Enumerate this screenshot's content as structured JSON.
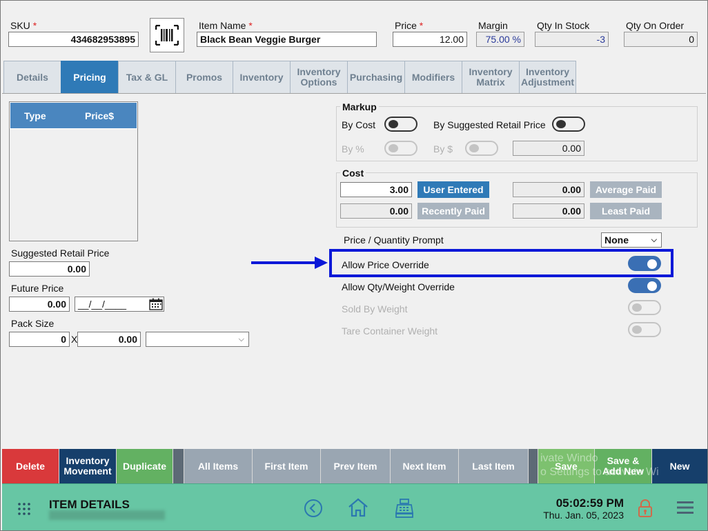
{
  "header": {
    "sku_label": "SKU",
    "sku_value": "434682953895",
    "item_name_label": "Item Name",
    "item_name_value": "Black Bean Veggie Burger",
    "price_label": "Price",
    "price_value": "12.00",
    "margin_label": "Margin",
    "margin_value": "75.00 %",
    "qty_in_stock_label": "Qty In Stock",
    "qty_in_stock_value": "-3",
    "qty_on_order_label": "Qty On Order",
    "qty_on_order_value": "0",
    "required_mark": "*"
  },
  "tabs": [
    {
      "line1": "Details",
      "line2": ""
    },
    {
      "line1": "Pricing",
      "line2": ""
    },
    {
      "line1": "Tax & GL",
      "line2": ""
    },
    {
      "line1": "Promos",
      "line2": ""
    },
    {
      "line1": "Inventory",
      "line2": ""
    },
    {
      "line1": "Inventory",
      "line2": "Options"
    },
    {
      "line1": "Purchasing",
      "line2": ""
    },
    {
      "line1": "Modifiers",
      "line2": ""
    },
    {
      "line1": "Inventory",
      "line2": "Matrix"
    },
    {
      "line1": "Inventory",
      "line2": "Adjustment"
    }
  ],
  "active_tab": "Pricing",
  "price_table": {
    "col_type": "Type",
    "col_price": "Price$"
  },
  "left": {
    "suggested_retail_label": "Suggested Retail Price",
    "suggested_retail_value": "0.00",
    "future_price_label": "Future Price",
    "future_price_value": "0.00",
    "future_date_value": "__/__/____",
    "pack_size_label": "Pack Size",
    "pack_qty_value": "0",
    "pack_x": "X",
    "pack_price_value": "0.00",
    "pack_unit_value": ""
  },
  "markup": {
    "title": "Markup",
    "by_cost_label": "By Cost",
    "by_suggested_label": "By Suggested Retail Price",
    "by_percent_label": "By %",
    "by_dollar_label": "By $",
    "markup_value": "0.00"
  },
  "cost": {
    "title": "Cost",
    "cost_value": "3.00",
    "user_entered_label": "User Entered",
    "recently_paid_value": "0.00",
    "recently_paid_label": "Recently Paid",
    "average_paid_value": "0.00",
    "average_paid_label": "Average Paid",
    "least_paid_value": "0.00",
    "least_paid_label": "Least Paid"
  },
  "options": {
    "price_qty_prompt_label": "Price / Quantity Prompt",
    "price_qty_prompt_value": "None",
    "allow_price_override_label": "Allow Price Override",
    "allow_price_override": true,
    "allow_qty_weight_override_label": "Allow Qty/Weight Override",
    "allow_qty_weight_override": true,
    "sold_by_weight_label": "Sold By Weight",
    "sold_by_weight": false,
    "tare_container_weight_label": "Tare Container Weight",
    "tare_container_weight": false
  },
  "actions": {
    "delete": "Delete",
    "inventory_movement_1": "Inventory",
    "inventory_movement_2": "Movement",
    "duplicate": "Duplicate",
    "all_items": "All Items",
    "first_item": "First Item",
    "prev_item": "Prev Item",
    "next_item": "Next Item",
    "last_item": "Last Item",
    "save": "Save",
    "save_add_new_1": "Save &",
    "save_add_new_2": "Add New",
    "new": "New"
  },
  "watermark": {
    "line1": "ivate Windo",
    "line2": "o Settings to activate Wi"
  },
  "footer": {
    "title": "ITEM DETAILS",
    "time": "05:02:59 PM",
    "date": "Thu. Jan. 05, 2023"
  },
  "colors": {
    "accent_blue": "#2f7ab7",
    "footer_green": "#67c6a4",
    "highlight": "#0a18d8",
    "delete_red": "#d9393b"
  }
}
